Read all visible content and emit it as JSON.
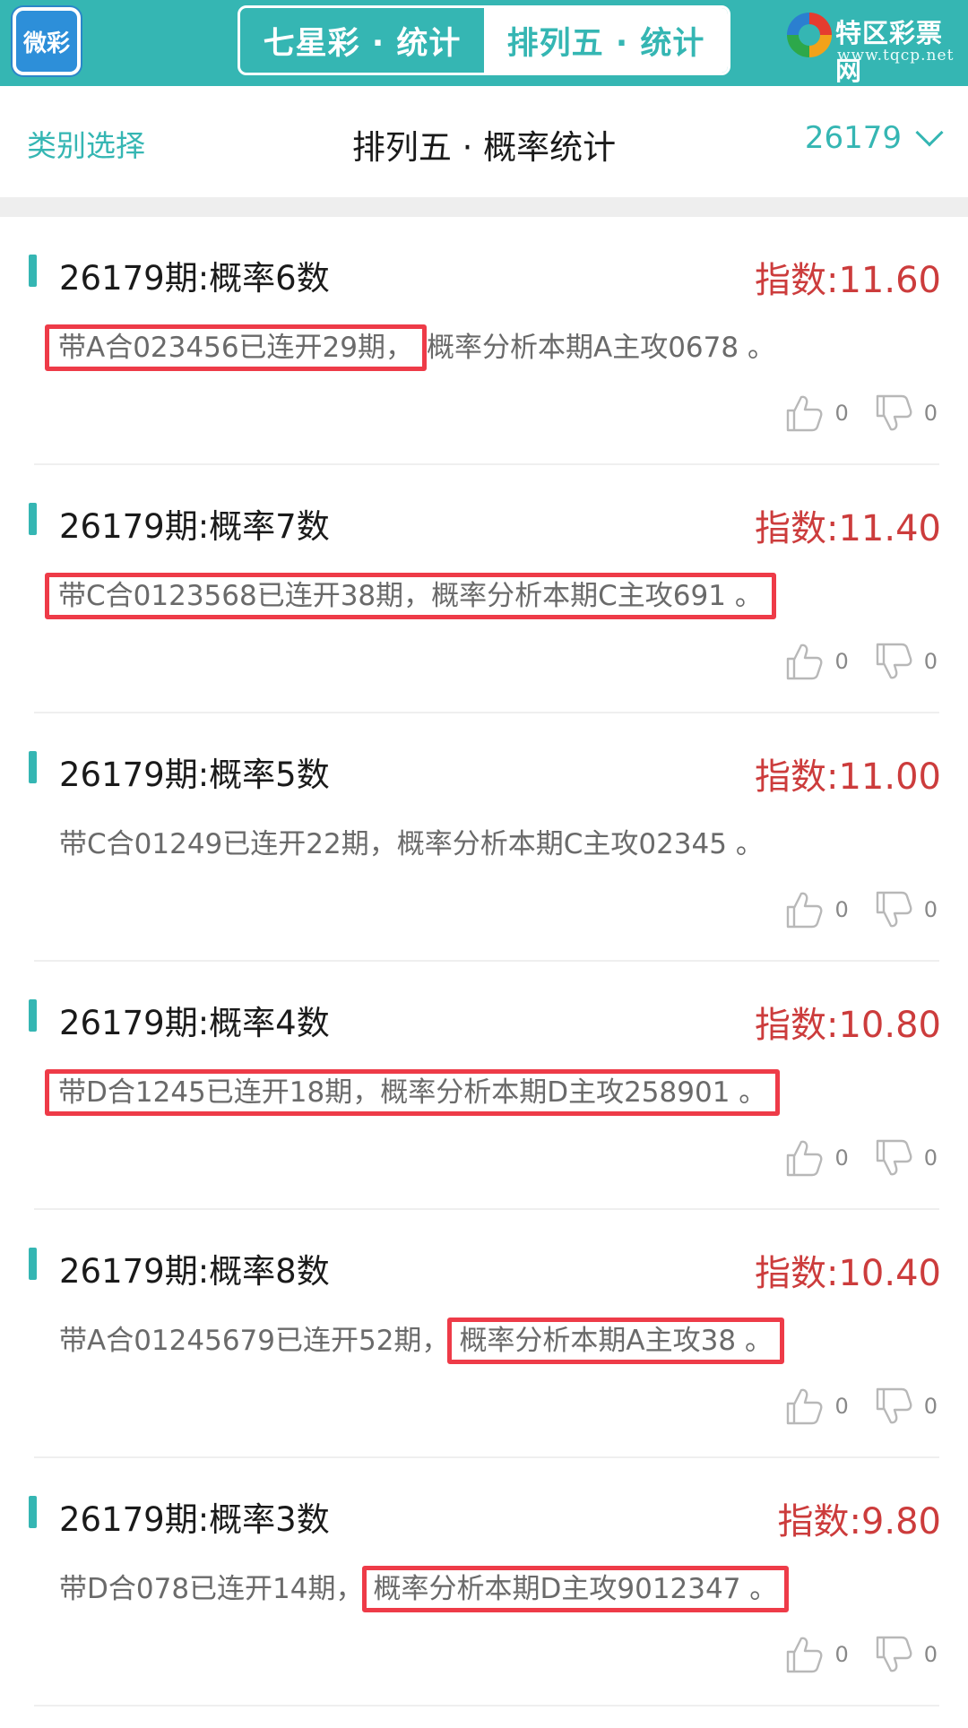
{
  "header": {
    "logo_text": "微彩",
    "tabs": [
      {
        "label": "七星彩 · 统计",
        "active": false
      },
      {
        "label": "排列五 · 统计",
        "active": true
      }
    ],
    "brand_name": "特区彩票网",
    "brand_url": "www.tqcp.net"
  },
  "subheader": {
    "category_select": "类别选择",
    "title": "排列五 · 概率统计",
    "period": "26179"
  },
  "colors": {
    "accent": "#35b6b3",
    "index_red": "#cc3c3c",
    "highlight_border": "#ee3b48"
  },
  "items": [
    {
      "title": "26179期:概率6数",
      "index": "指数:11.60",
      "desc_a": "带A合023456已连开29期，",
      "desc_b": "概率分析本期A主攻0678 。",
      "likes": "0",
      "dislikes": "0"
    },
    {
      "title": "26179期:概率7数",
      "index": "指数:11.40",
      "desc_a": "带C合0123568已连开38期，概率分析本期C主攻691 。",
      "desc_b": "",
      "likes": "0",
      "dislikes": "0"
    },
    {
      "title": "26179期:概率5数",
      "index": "指数:11.00",
      "desc_a": "带C合01249已连开22期，概率分析本期C主攻02345 。",
      "desc_b": "",
      "likes": "0",
      "dislikes": "0"
    },
    {
      "title": "26179期:概率4数",
      "index": "指数:10.80",
      "desc_a": "带D合1245已连开18期，概率分析本期D主攻258901 。",
      "desc_b": "",
      "likes": "0",
      "dislikes": "0"
    },
    {
      "title": "26179期:概率8数",
      "index": "指数:10.40",
      "desc_a": "带A合01245679已连开52期，",
      "desc_b": "概率分析本期A主攻38 。",
      "likes": "0",
      "dislikes": "0"
    },
    {
      "title": "26179期:概率3数",
      "index": "指数:9.80",
      "desc_a": "带D合078已连开14期，",
      "desc_b": "概率分析本期D主攻9012347 。",
      "likes": "0",
      "dislikes": "0"
    }
  ]
}
